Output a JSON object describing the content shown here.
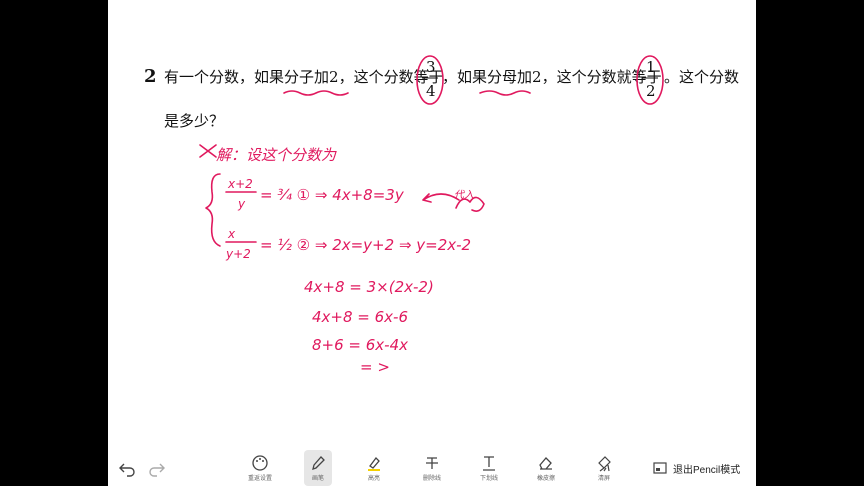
{
  "question": {
    "number": "2",
    "line1_a": "有一个分数，如果",
    "line1_b": "分子加",
    "line1_c": "2",
    "line1_d": "，这个分数等于",
    "frac1_num": "3",
    "frac1_den": "4",
    "line1_e": "，如果",
    "line1_f": "分母加",
    "line1_g": "2",
    "line1_h": "，这个分数就等于",
    "frac2_num": "1",
    "frac2_den": "2",
    "line1_i": "。这个分数",
    "line2": "是多少？"
  },
  "handwriting": {
    "heading": "解：设这个分数为",
    "eq1": "= ¾ ① ⇒ 4x+8=3y",
    "eq1_num": "x+2",
    "eq1_den": "y",
    "eq2": "= ½ ② ⇒ 2x=y+2 ⇒ y=2x-2",
    "eq2_num": "x",
    "eq2_den": "y+2",
    "note": "代入",
    "step1": "4x+8 = 3×(2x-2)",
    "step2": "4x+8 = 6x-6",
    "step3": "8+6 = 6x-4x",
    "step4": "= >"
  },
  "toolbar": {
    "undo_icon": "undo-icon",
    "redo_icon": "redo-icon",
    "tools": [
      {
        "label": "重返设置",
        "icon": "palette-icon"
      },
      {
        "label": "画笔",
        "icon": "pen-icon"
      },
      {
        "label": "高亮",
        "icon": "highlighter-icon"
      },
      {
        "label": "删除线",
        "icon": "strikethrough-icon"
      },
      {
        "label": "下划线",
        "icon": "underline-icon"
      },
      {
        "label": "橡皮擦",
        "icon": "eraser-icon"
      },
      {
        "label": "清屏",
        "icon": "clear-icon"
      }
    ],
    "exit_label": "退出Pencil模式",
    "accent": "#e0195e"
  }
}
